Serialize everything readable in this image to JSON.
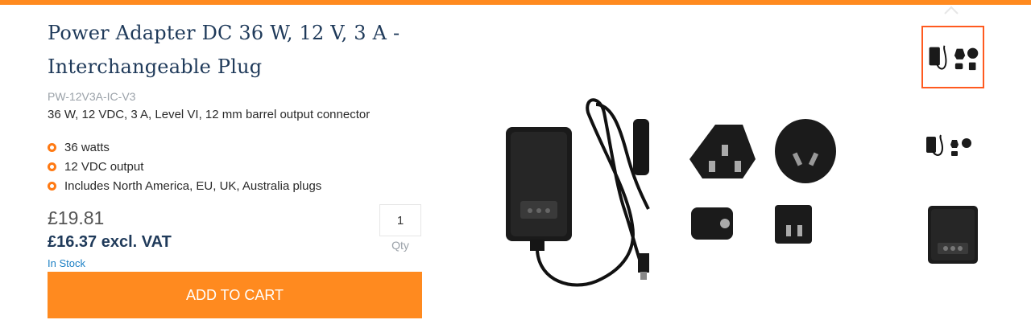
{
  "product": {
    "title_line1": "Power Adapter DC 36 W, 12 V, 3 A -",
    "title_line2": "Interchangeable Plug",
    "sku": "PW-12V3A-IC-V3",
    "description": "36 W, 12 VDC, 3 A, Level VI, 12 mm barrel output connector",
    "features": [
      "36 watts",
      "12 VDC output",
      "Includes North America, EU, UK, Australia plugs"
    ]
  },
  "pricing": {
    "price": "£19.81",
    "price_ex_vat": "£16.37 excl. VAT",
    "stock": "In Stock"
  },
  "quantity": {
    "value": "1",
    "label": "Qty"
  },
  "cart": {
    "button_label": "ADD TO CART"
  },
  "gallery": {
    "selected_index": 0,
    "thumbnails": [
      "adapter-with-plugs",
      "adapter-with-plugs",
      "adapter-closeup"
    ]
  },
  "colors": {
    "accent": "#ff8a1f",
    "title": "#1f3a5a",
    "stock": "#1b7fc4",
    "thumb_border": "#ff5a1f"
  }
}
